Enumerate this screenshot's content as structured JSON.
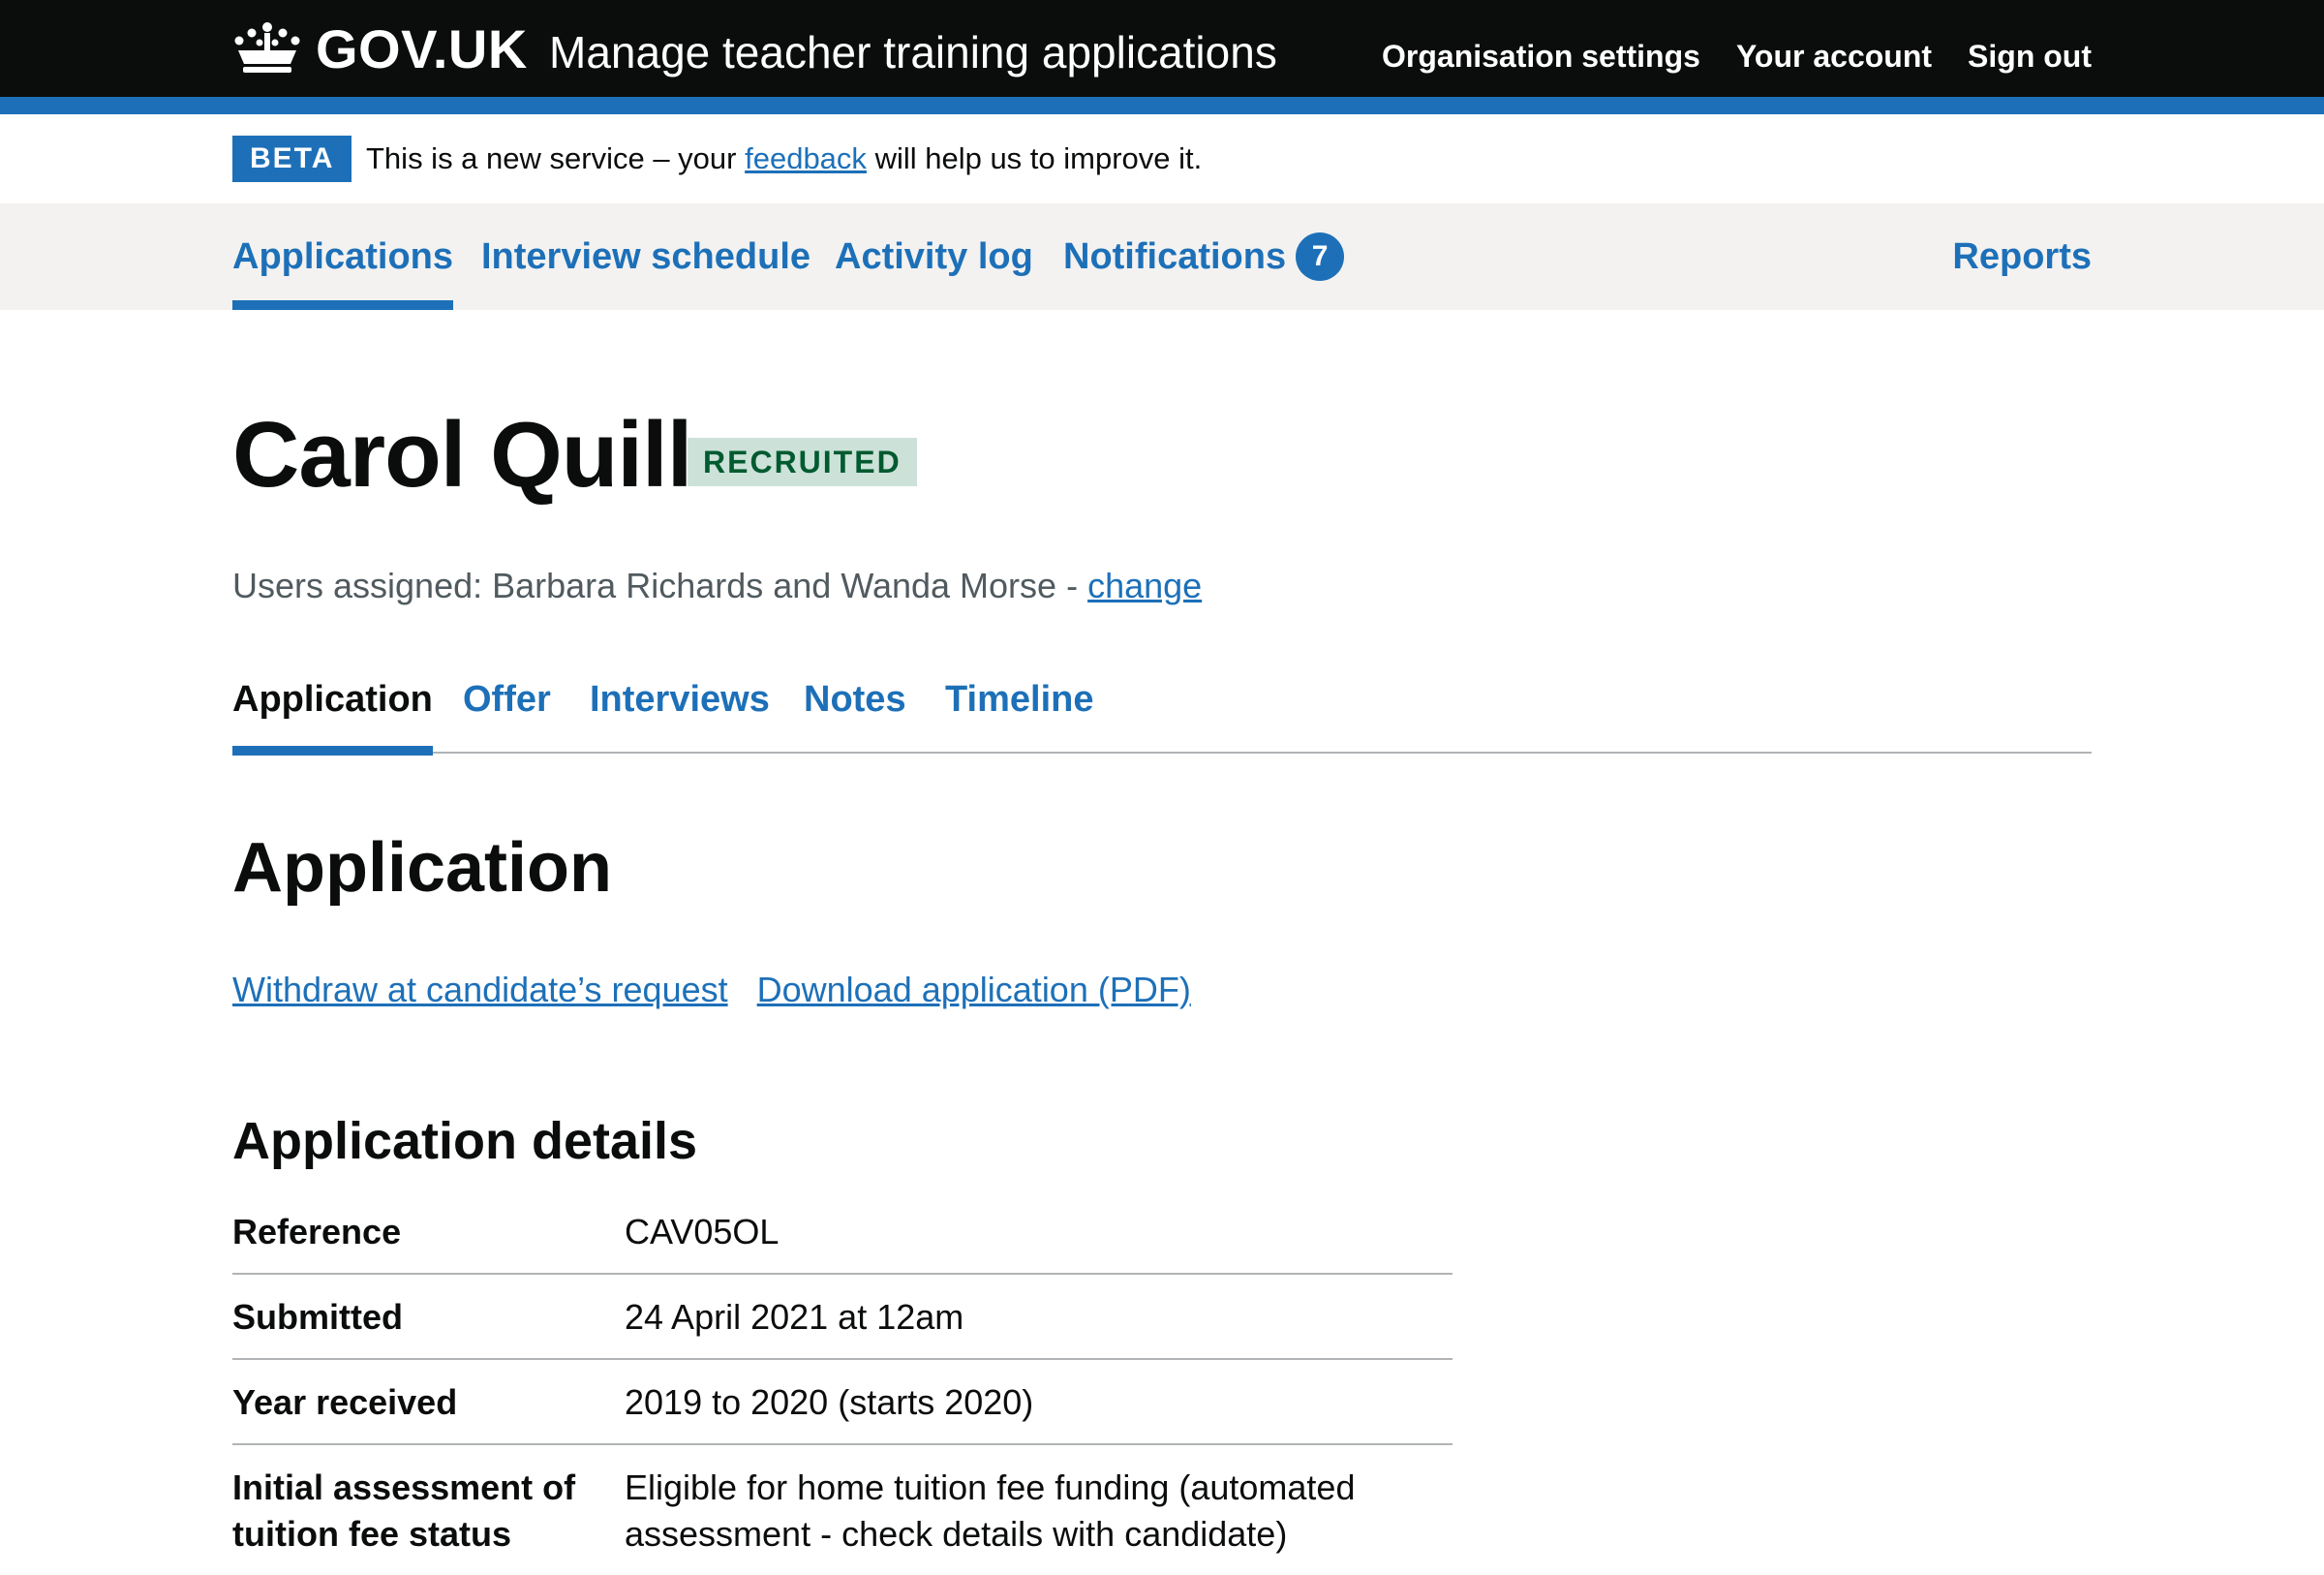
{
  "header": {
    "logotype": "GOV.UK",
    "service_name": "Manage teacher training applications",
    "nav": [
      "Organisation settings",
      "Your account",
      "Sign out"
    ]
  },
  "phase_banner": {
    "tag": "BETA",
    "text_before": "This is a new service – your",
    "link": "feedback",
    "text_after": "will help us to improve it."
  },
  "primary_nav": {
    "items": [
      "Applications",
      "Interview schedule",
      "Activity log",
      "Notifications"
    ],
    "notification_count": "7",
    "reports": "Reports",
    "current": "Applications"
  },
  "candidate": {
    "name": "Carol Quill",
    "status": "RECRUITED",
    "assigned_label": "Users assigned: Barbara Richards and Wanda Morse -",
    "change_link": "change"
  },
  "sub_tabs": {
    "items": [
      "Application",
      "Offer",
      "Interviews",
      "Notes",
      "Timeline"
    ],
    "current": "Application"
  },
  "main": {
    "heading": "Application",
    "actions": [
      "Withdraw at candidate’s request",
      "Download application (PDF)"
    ],
    "details_heading": "Application details",
    "rows": [
      {
        "key": "Reference",
        "value": "CAV05OL"
      },
      {
        "key": "Submitted",
        "value": "24 April 2021 at 12am"
      },
      {
        "key": "Year received",
        "value": "2019 to 2020 (starts 2020)"
      },
      {
        "key": "Initial assessment of tuition fee status",
        "value": "Eligible for home tuition fee funding (automated assessment - check details with candidate)"
      }
    ]
  },
  "colors": {
    "header_bg": "#0b0c0c",
    "brand_blue": "#1d70b8",
    "nav_bg": "#f3f2f1",
    "recruited_bg": "#cce2d8",
    "recruited_text": "#005a30"
  }
}
